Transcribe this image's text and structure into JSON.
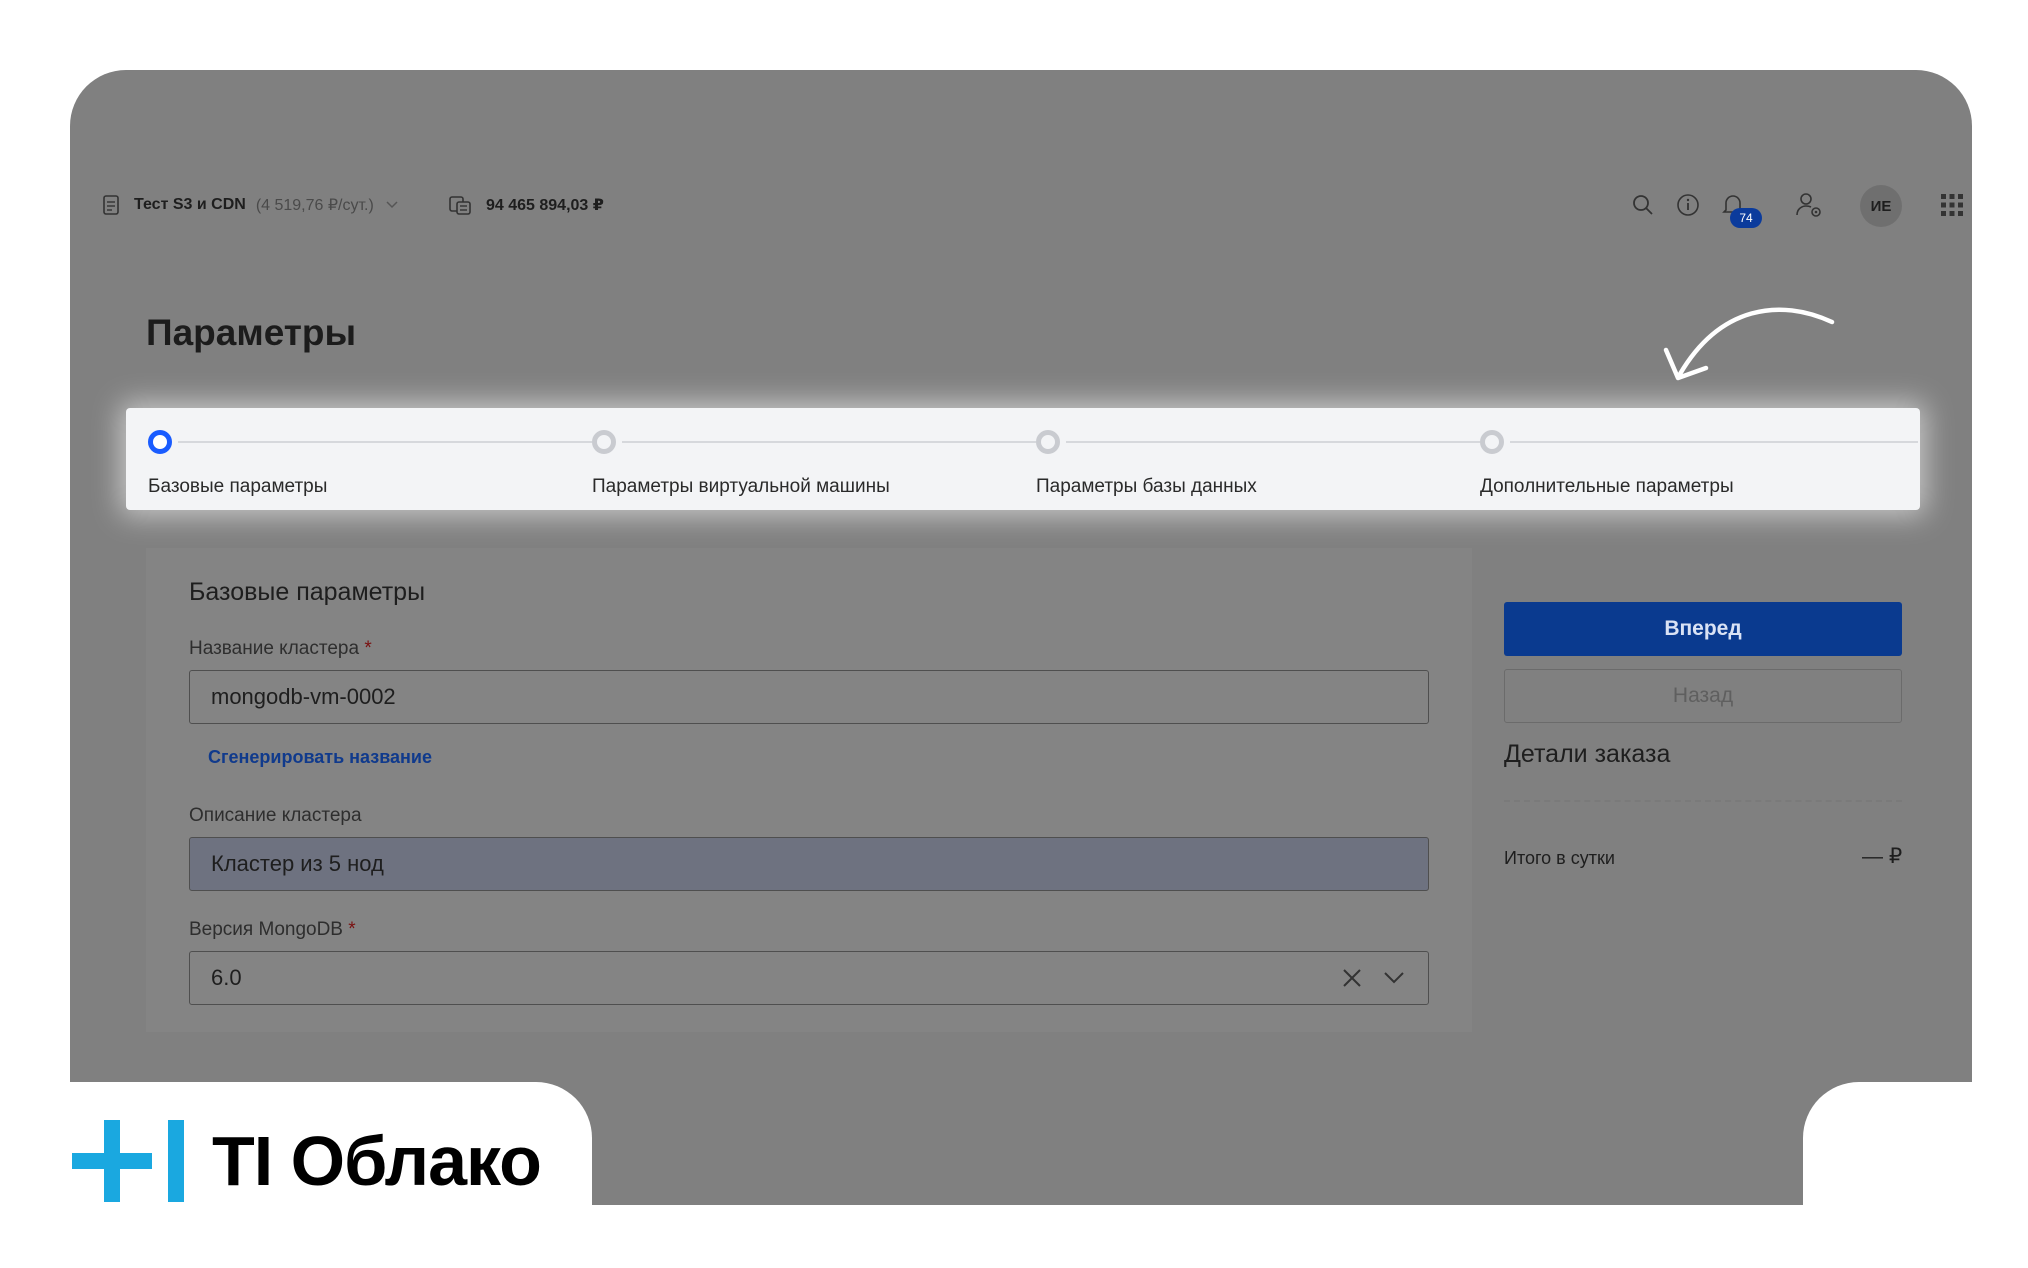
{
  "topbar": {
    "project_name": "Тест S3 и CDN",
    "project_cost": "(4 519,76 ₽/сут.)",
    "balance": "94 465 894,03 ₽",
    "notifications_count": "74",
    "user_initials": "ИЕ"
  },
  "page": {
    "title": "Параметры"
  },
  "stepper": {
    "steps": [
      {
        "label": "Базовые параметры",
        "active": true
      },
      {
        "label": "Параметры виртуальной машины",
        "active": false
      },
      {
        "label": "Параметры базы данных",
        "active": false
      },
      {
        "label": "Дополнительные параметры",
        "active": false
      }
    ]
  },
  "form": {
    "section_title": "Базовые параметры",
    "cluster_name_label": "Название кластера",
    "cluster_name_value": "mongodb-vm-0002",
    "generate_link": "Сгенерировать название",
    "description_label": "Описание кластера",
    "description_value": "Кластер из 5 нод",
    "version_label": "Версия MongoDB",
    "version_value": "6.0",
    "required_mark": "*"
  },
  "sidebar": {
    "next_button": "Вперед",
    "back_button": "Назад",
    "details_title": "Детали заказа",
    "total_label": "Итого в сутки",
    "total_value": "— ₽"
  },
  "logo": {
    "text": "TI Облако"
  },
  "colors": {
    "accent": "#0a3a8f",
    "step_active": "#1a5cff",
    "logo_blue": "#1aa8e0",
    "overlay": "#808080"
  }
}
